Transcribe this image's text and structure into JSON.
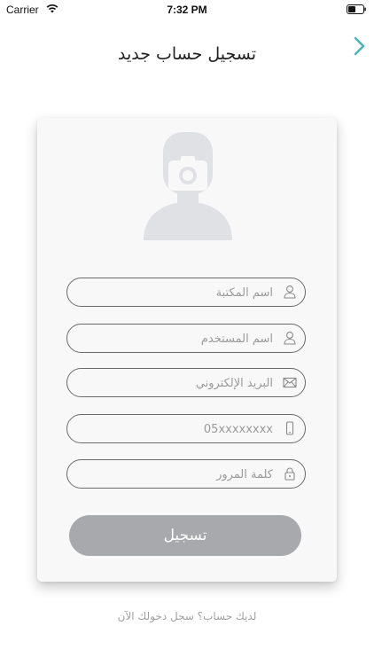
{
  "status_bar": {
    "carrier": "Carrier",
    "time": "7:32 PM"
  },
  "header": {
    "title": "تسجيل حساب جديد",
    "back_icon": "chevron-right-icon"
  },
  "form": {
    "avatar_icon": "user-camera-avatar-icon",
    "fields": [
      {
        "placeholder": "اسم المكتبة",
        "value": "",
        "icon": "user-icon"
      },
      {
        "placeholder": "اسم المستخدم",
        "value": "",
        "icon": "user-icon"
      },
      {
        "placeholder": "البريد الإلكتروني",
        "value": "",
        "icon": "envelope-icon"
      },
      {
        "placeholder": "05xxxxxxxx",
        "value": "",
        "icon": "mobile-phone-icon"
      },
      {
        "placeholder": "كلمة المرور",
        "value": "",
        "icon": "lock-icon"
      }
    ],
    "submit_label": "تسجيل"
  },
  "footer": {
    "login_prompt": "لديك حساب؟ سجل دخولك الآن"
  },
  "colors": {
    "accent": "#4fb3b6",
    "button": "#a8a9ad",
    "card": "#f8f8f9",
    "field_border": "#6a6a6a"
  }
}
